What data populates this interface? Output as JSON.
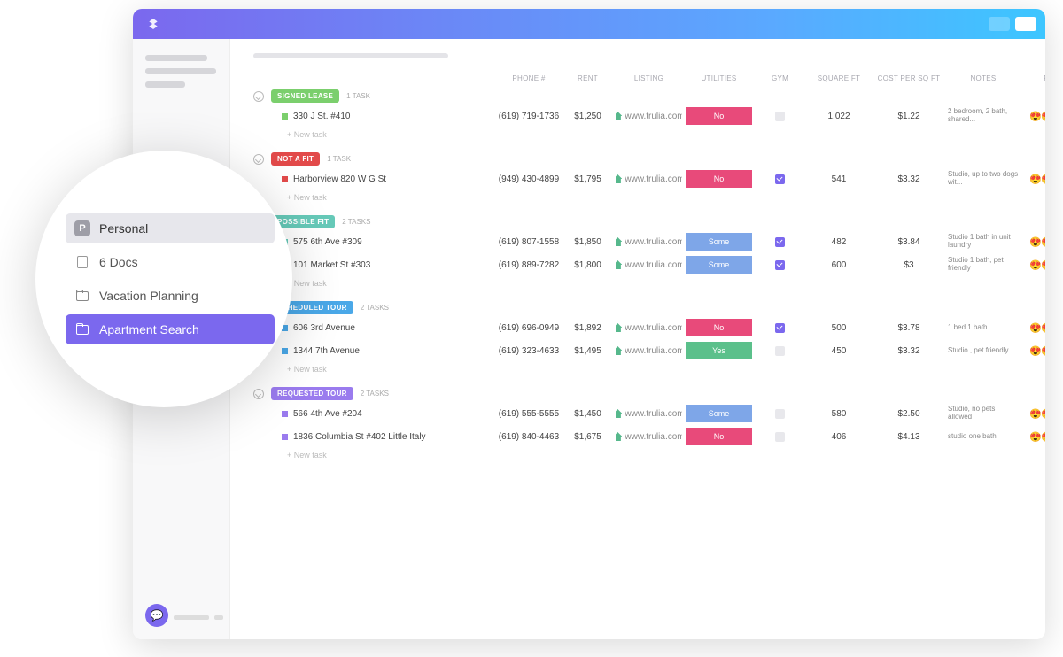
{
  "popover": {
    "items": [
      {
        "label": "Personal",
        "badge": "P",
        "type": "space"
      },
      {
        "label": "6 Docs",
        "type": "docs"
      },
      {
        "label": "Vacation Planning",
        "type": "folder"
      },
      {
        "label": "Apartment Search",
        "type": "folder",
        "active": true
      }
    ]
  },
  "columns": [
    "PHONE #",
    "RENT",
    "LISTING",
    "UTILITIES",
    "GYM",
    "SQUARE FT",
    "COST PER SQ FT",
    "NOTES",
    "RATING"
  ],
  "new_task_label": "+ New task",
  "listing_text": "www.trulia.com",
  "util_colors": {
    "No": "#e84a7a",
    "Yes": "#5bc08b",
    "Some": "#7ea6e8"
  },
  "groups": [
    {
      "name": "SIGNED LEASE",
      "color": "#7bcf6d",
      "task_count": "1 TASK",
      "rows": [
        {
          "sq": "#7bcf6d",
          "title": "330 J St. #410",
          "phone": "(619) 719-1736",
          "rent": "$1,250",
          "util": "No",
          "gym": false,
          "sqft": "1,022",
          "cost": "$1.22",
          "notes": "2 bedroom, 2 bath, shared...",
          "rating": "😍😍😍😍😍"
        }
      ]
    },
    {
      "name": "NOT A FIT",
      "color": "#e24a4a",
      "task_count": "1 TASK",
      "rows": [
        {
          "sq": "#e24a4a",
          "title": "Harborview 820 W G St",
          "phone": "(949) 430-4899",
          "rent": "$1,795",
          "util": "No",
          "gym": true,
          "sqft": "541",
          "cost": "$3.32",
          "notes": "Studio, up to two dogs wit...",
          "rating": "😍😍😍😍🤖"
        }
      ]
    },
    {
      "name": "POSSIBLE FIT",
      "color": "#66c9b8",
      "task_count": "2 TASKS",
      "rows": [
        {
          "sq": "#66c9b8",
          "title": "575 6th Ave #309",
          "phone": "(619) 807-1558",
          "rent": "$1,850",
          "util": "Some",
          "gym": true,
          "sqft": "482",
          "cost": "$3.84",
          "notes": "Studio 1 bath in unit laundry",
          "rating": "😍😍😍😍🤖"
        },
        {
          "sq": "#66c9b8",
          "title": "101 Market St #303",
          "phone": "(619) 889-7282",
          "rent": "$1,800",
          "util": "Some",
          "gym": true,
          "sqft": "600",
          "cost": "$3",
          "notes": "Studio 1 bath, pet friendly",
          "rating": "😍😍😍😍🤖"
        }
      ]
    },
    {
      "name": "SCHEDULED TOUR",
      "color": "#4aa8e8",
      "task_count": "2 TASKS",
      "rows": [
        {
          "sq": "#4aa8e8",
          "title": "606 3rd Avenue",
          "phone": "(619) 696-0949",
          "rent": "$1,892",
          "util": "No",
          "gym": true,
          "sqft": "500",
          "cost": "$3.78",
          "notes": "1 bed 1 bath",
          "rating": "😍😍🤖🤖🤖"
        },
        {
          "sq": "#4aa8e8",
          "title": "1344 7th Avenue",
          "phone": "(619) 323-4633",
          "rent": "$1,495",
          "util": "Yes",
          "gym": false,
          "sqft": "450",
          "cost": "$3.32",
          "notes": "Studio , pet friendly",
          "rating": "😍😍😍😍😍"
        }
      ]
    },
    {
      "name": "REQUESTED TOUR",
      "color": "#9a7bee",
      "task_count": "2 TASKS",
      "rows": [
        {
          "sq": "#9a7bee",
          "title": "566 4th Ave #204",
          "phone": "(619) 555-5555",
          "rent": "$1,450",
          "util": "Some",
          "gym": false,
          "sqft": "580",
          "cost": "$2.50",
          "notes": "Studio, no pets allowed",
          "rating": "😍😍😍😍🤖"
        },
        {
          "sq": "#9a7bee",
          "title": "1836 Columbia St #402 Little Italy",
          "phone": "(619) 840-4463",
          "rent": "$1,675",
          "util": "No",
          "gym": false,
          "sqft": "406",
          "cost": "$4.13",
          "notes": "studio one bath",
          "rating": "😍😍😍😍🤖"
        }
      ]
    }
  ]
}
